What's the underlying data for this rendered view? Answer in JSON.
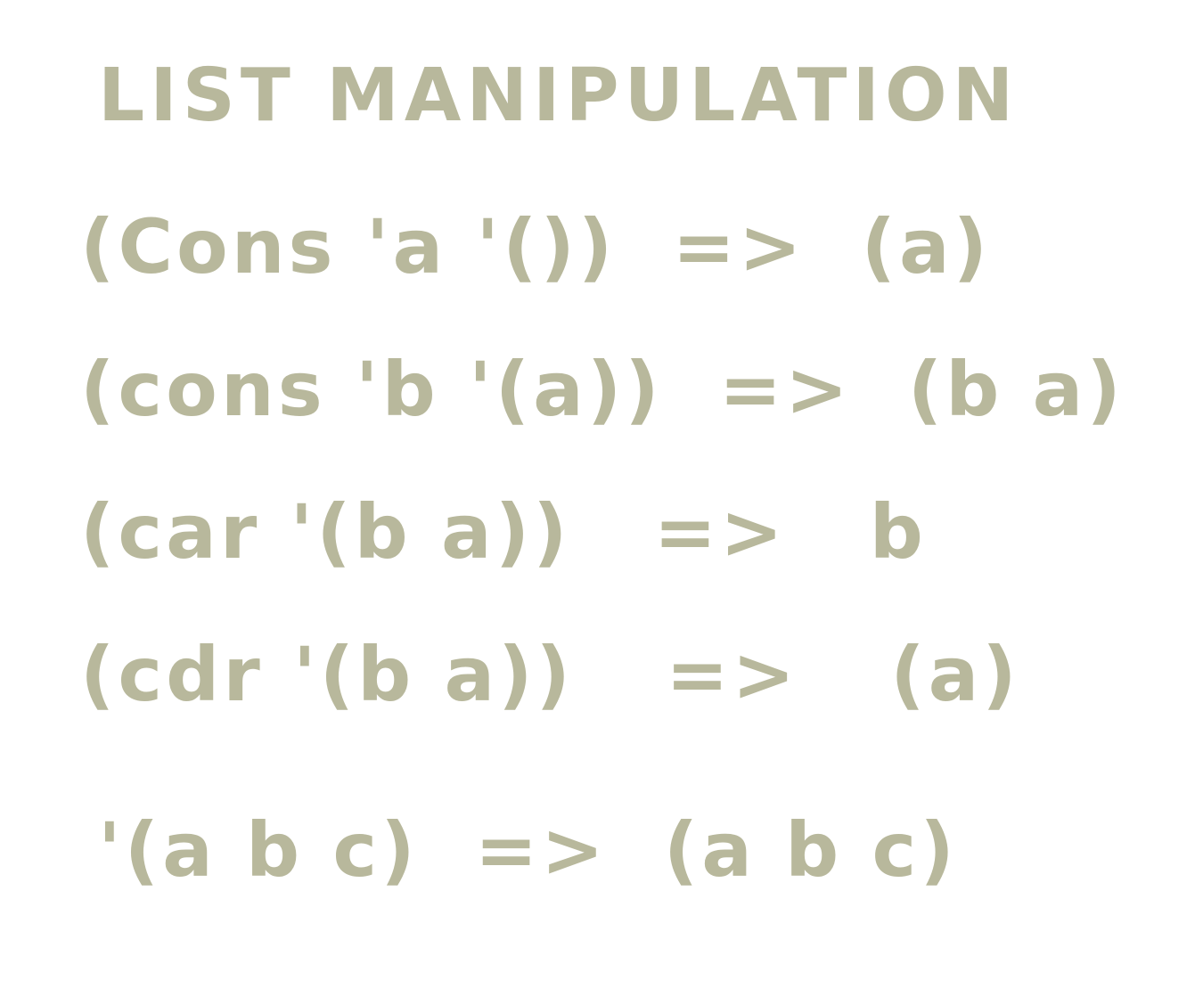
{
  "title": "LIST MANIPULATION",
  "lines": [
    {
      "expr": "(Cons 'a '())",
      "arrow": "=>",
      "result": "(a)"
    },
    {
      "expr": "(cons 'b '(a))",
      "arrow": "=>",
      "result": "(b a)"
    },
    {
      "expr": "(car '(b a))",
      "arrow": "=>",
      "result": "b"
    },
    {
      "expr": "(cdr '(b a))",
      "arrow": "=>",
      "result": "(a)"
    },
    {
      "expr": "'(a b c)",
      "arrow": "=>",
      "result": "(a b c)"
    }
  ],
  "colors": {
    "ink": "#b8b89c",
    "background": "#ffffff"
  }
}
